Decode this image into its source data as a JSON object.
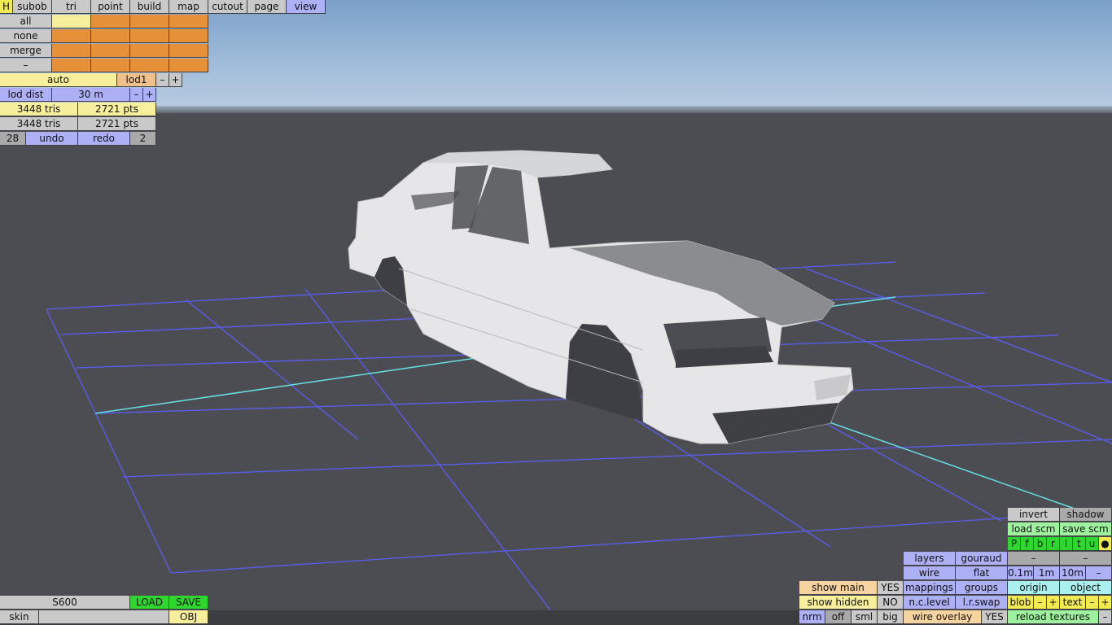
{
  "colors": {
    "sky": "#9fbcd9",
    "floor": "#4b4d52",
    "grid": "#5a5ef0",
    "axis": "#67e0e6",
    "car_body": "#e8e8ea"
  },
  "menu": {
    "h": "H",
    "tabs": [
      "subob",
      "tri",
      "point",
      "build",
      "map",
      "cutout",
      "page",
      "view"
    ]
  },
  "selection": {
    "all": "all",
    "none": "none",
    "merge": "merge",
    "minus": "–"
  },
  "lod": {
    "auto": "auto",
    "lod1": "lod1",
    "minus": "–",
    "plus": "+",
    "dist_label": "lod dist",
    "dist_value": "30 m",
    "dist_minus": "–",
    "dist_plus": "+"
  },
  "stats": {
    "tris1": "3448 tris",
    "pts1": "2721 pts",
    "tris2": "3448 tris",
    "pts2": "2721 pts"
  },
  "history": {
    "count": "28",
    "undo": "undo",
    "redo": "redo",
    "redo_count": "2"
  },
  "file": {
    "name": "S600",
    "load": "LOAD",
    "save": "SAVE",
    "skin": "skin",
    "obj": "OBJ"
  },
  "show": {
    "main": "show main",
    "main_val": "YES",
    "hidden": "show hidden",
    "hidden_val": "NO",
    "nrm": "nrm",
    "off": "off",
    "sml": "sml",
    "big": "big"
  },
  "render": {
    "layers": "layers",
    "gouraud": "gouraud",
    "wire": "wire",
    "flat": "flat",
    "mappings": "mappings",
    "groups": "groups",
    "nclevel": "n.c.level",
    "lrswap": "l.r.swap",
    "wire_overlay": "wire overlay",
    "wire_overlay_val": "YES"
  },
  "right": {
    "invert": "invert",
    "shadow": "shadow",
    "load_scm": "load scm",
    "save_scm": "save scm",
    "flags": [
      "P",
      "f",
      "b",
      "r",
      "l",
      "t",
      "u",
      "●"
    ],
    "dash1": "–",
    "dash2": "–",
    "s01": "0.1m",
    "s1": "1m",
    "s10": "10m",
    "sdash": "–",
    "origin": "origin",
    "object": "object",
    "blob": "blob",
    "blob_minus": "–",
    "blob_plus": "+",
    "text": "text",
    "text_minus": "–",
    "text_plus": "+",
    "reload": "reload textures",
    "reload_minus": "–"
  }
}
